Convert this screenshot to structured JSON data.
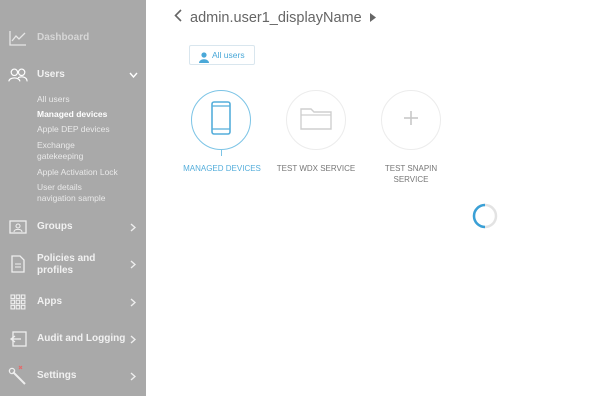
{
  "page": {
    "title": "admin.user1_displayName"
  },
  "header": {
    "all_users_chip": "All users"
  },
  "sidebar": {
    "items": [
      {
        "label": "Dashboard",
        "icon": "chart-line-icon"
      },
      {
        "label": "Users",
        "icon": "users-icon",
        "expanded": true
      },
      {
        "label": "Groups",
        "icon": "groups-icon"
      },
      {
        "label": "Policies and profiles",
        "icon": "document-icon"
      },
      {
        "label": "Apps",
        "icon": "apps-grid-icon"
      },
      {
        "label": "Audit and Logging",
        "icon": "audit-icon"
      },
      {
        "label": "Settings",
        "icon": "wrench-icon"
      }
    ],
    "users_subitems": [
      "All users",
      "Managed devices",
      "Apple DEP devices",
      "Exchange gatekeeping",
      "Apple Activation Lock",
      "User details navigation sample"
    ],
    "active_subitem": "Managed devices",
    "policies_line1": "Policies and",
    "policies_line2": "profiles",
    "exchange_line1": "Exchange",
    "exchange_line2": "gatekeeping",
    "userdetails_line1": "User details",
    "userdetails_line2": "navigation sample"
  },
  "services": [
    {
      "label": "MANAGED DEVICES",
      "icon": "phone-icon",
      "active": true
    },
    {
      "label": "TEST WDX SERVICE",
      "icon": "folder-icon",
      "active": false
    },
    {
      "label_line1": "TEST SNAPIN",
      "label_line2": "SERVICE",
      "icon": "plus-icon",
      "active": false
    }
  ],
  "colors": {
    "sidebar_bg": "#a9a9a9",
    "accent": "#4aa8d8",
    "spinner": "#3aa0d6"
  },
  "status": {
    "loading": true
  }
}
